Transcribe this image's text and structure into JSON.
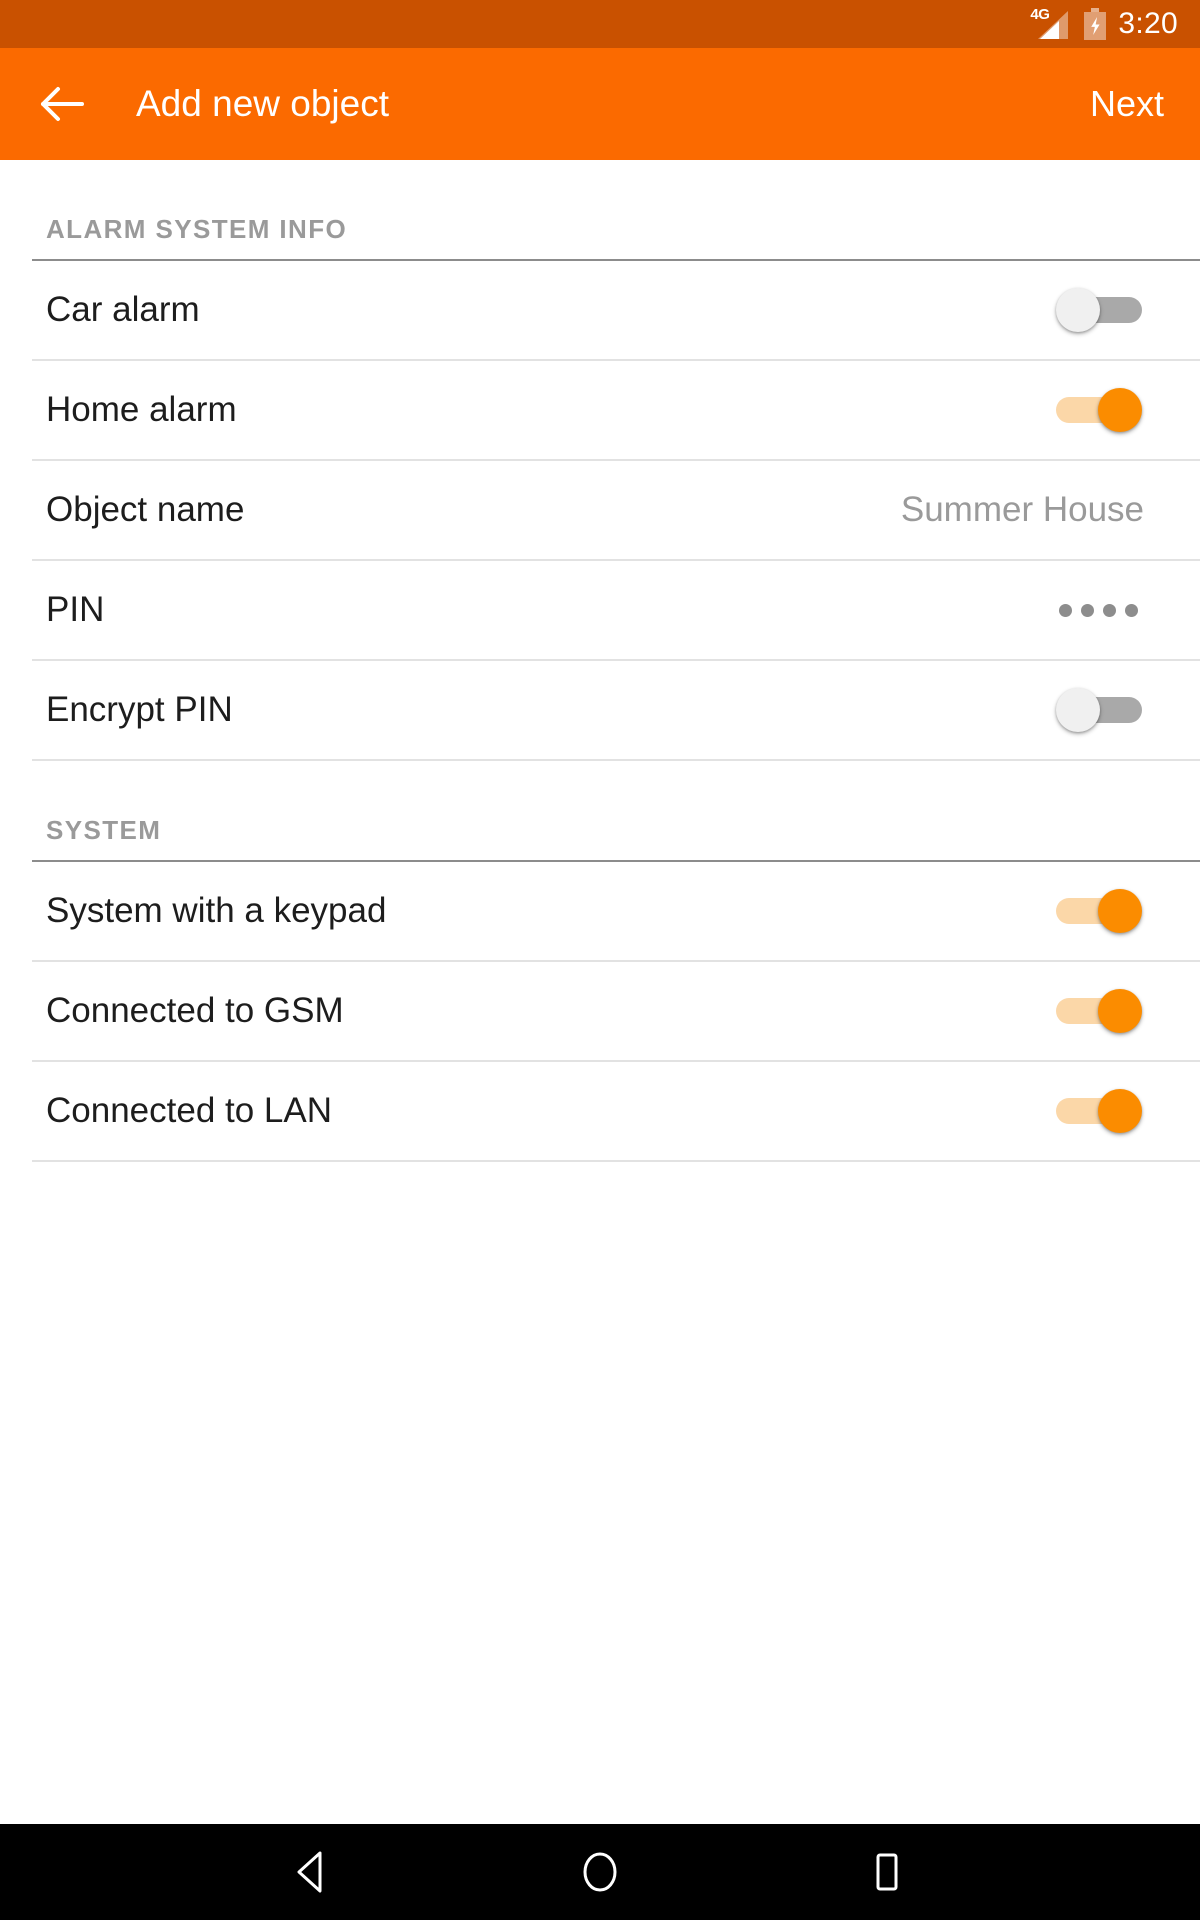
{
  "status_bar": {
    "network": "4G",
    "signal_icon": "signal-bars-icon",
    "battery_icon": "battery-charging-icon",
    "time": "3:20",
    "background_color": "#c95100"
  },
  "app_bar": {
    "back_icon": "back-arrow-icon",
    "title": "Add new object",
    "next_label": "Next",
    "background_color": "#fb6a00",
    "text_color": "#ffffff"
  },
  "sections": [
    {
      "header": "ALARM SYSTEM INFO",
      "rows": [
        {
          "label": "Car alarm",
          "type": "switch",
          "state": "off",
          "value": ""
        },
        {
          "label": "Home alarm",
          "type": "switch",
          "state": "on",
          "value": ""
        },
        {
          "label": "Object name",
          "type": "value",
          "state": "",
          "value": "Summer House"
        },
        {
          "label": "PIN",
          "type": "masked",
          "state": "",
          "value": "••••",
          "mask_count": 4
        },
        {
          "label": "Encrypt PIN",
          "type": "switch",
          "state": "off",
          "value": ""
        }
      ]
    },
    {
      "header": "SYSTEM",
      "rows": [
        {
          "label": "System with a keypad",
          "type": "switch",
          "state": "on",
          "value": ""
        },
        {
          "label": "Connected to GSM",
          "type": "switch",
          "state": "on",
          "value": ""
        },
        {
          "label": "Connected to LAN",
          "type": "switch",
          "state": "on",
          "value": ""
        }
      ]
    }
  ],
  "nav_bar": {
    "back_icon": "nav-back-triangle-icon",
    "home_icon": "nav-home-circle-icon",
    "recents_icon": "nav-recents-square-icon",
    "background_color": "#000000"
  },
  "theme": {
    "accent_on": "#fb8c00",
    "accent_on_track": "#fbd7a8",
    "switch_off_track": "#a9a9a9",
    "switch_off_thumb": "#f0f0f0",
    "section_header_color": "#9a9a9a",
    "value_text_color": "#9a9a9a",
    "label_text_color": "#1d1d1d"
  }
}
